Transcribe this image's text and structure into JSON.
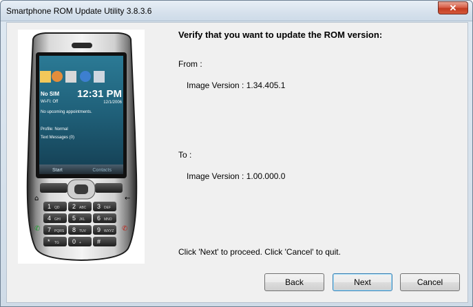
{
  "window": {
    "title": "Smartphone ROM Update Utility 3.8.3.6",
    "close_label": "✕"
  },
  "main": {
    "heading": "Verify that you want to update the ROM version:",
    "from_label": "From :",
    "from_value": "Image Version : 1.34.405.1",
    "to_label": "To :",
    "to_value": "Image Version : 1.00.000.0",
    "instruction": "Click 'Next' to proceed. Click 'Cancel' to quit."
  },
  "phone_screen": {
    "sim": "No SIM",
    "wifi": "Wi-Fi: Off",
    "time": "12:31 PM",
    "date": "12/1/2006",
    "appointments": "No upcoming appointments.",
    "profile": "Profile: Normal",
    "messages": "Text Messages (0)",
    "softkey_left": "Start",
    "softkey_right": "Contacts"
  },
  "phone_keys": [
    {
      "num": "1",
      "letters": "QD"
    },
    {
      "num": "2",
      "letters": "ABC"
    },
    {
      "num": "3",
      "letters": "DEF"
    },
    {
      "num": "4",
      "letters": "GHI"
    },
    {
      "num": "5",
      "letters": "JKL"
    },
    {
      "num": "6",
      "letters": "MNO"
    },
    {
      "num": "7",
      "letters": "PQRS"
    },
    {
      "num": "8",
      "letters": "TUV"
    },
    {
      "num": "9",
      "letters": "WXYZ"
    },
    {
      "num": "*",
      "letters": "TG"
    },
    {
      "num": "0",
      "letters": "+"
    },
    {
      "num": "#",
      "letters": ""
    }
  ],
  "buttons": {
    "back": "Back",
    "next": "Next",
    "cancel": "Cancel"
  }
}
